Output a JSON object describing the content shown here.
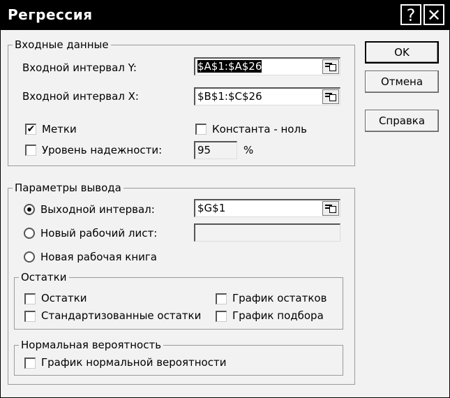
{
  "window": {
    "title": "Регрессия",
    "help_glyph": "?",
    "close_glyph": "✕"
  },
  "input_group": {
    "legend": "Входные данные",
    "y_range_label": "Входной интервал Y:",
    "y_range_value": "$A$1:$A$26",
    "x_range_label": "Входной интервал X:",
    "x_range_value": "$B$1:$C$26",
    "labels_checkbox": {
      "label": "Метки",
      "checked": true
    },
    "constant_zero_checkbox": {
      "label": "Константа - ноль",
      "checked": false
    },
    "confidence_checkbox": {
      "label": "Уровень надежности:",
      "checked": false
    },
    "confidence_value": "95",
    "confidence_unit": "%"
  },
  "output_group": {
    "legend": "Параметры вывода",
    "output_range_radio": {
      "label": "Выходной интервал:",
      "selected": true
    },
    "output_range_value": "$G$1",
    "new_sheet_radio": {
      "label": "Новый рабочий лист:",
      "selected": false
    },
    "new_sheet_value": "",
    "new_workbook_radio": {
      "label": "Новая рабочая книга",
      "selected": false
    }
  },
  "residuals_group": {
    "legend": "Остатки",
    "residuals": {
      "label": "Остатки",
      "checked": false
    },
    "standardized": {
      "label": "Стандартизованные остатки",
      "checked": false
    },
    "residual_plots": {
      "label": "График остатков",
      "checked": false
    },
    "line_fit_plots": {
      "label": "График подбора",
      "checked": false
    }
  },
  "normal_group": {
    "legend": "Нормальная вероятность",
    "normal_plot": {
      "label": "График нормальной вероятности",
      "checked": false
    }
  },
  "buttons": {
    "ok": "OK",
    "cancel": "Отмена",
    "help": "Справка"
  }
}
